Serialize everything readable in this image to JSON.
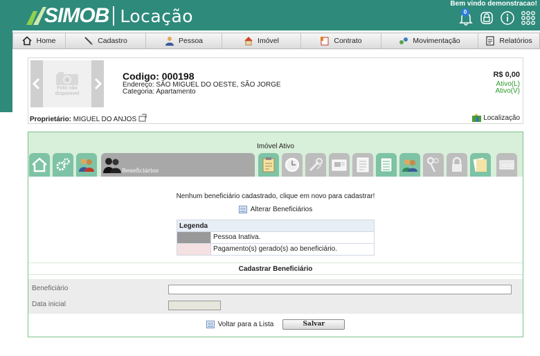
{
  "header": {
    "logo_simob": "SIMOB",
    "logo_locacao": "Locação",
    "welcome": "Bem vindo demonstracao!",
    "notifications_count": "0",
    "icons": [
      "bell-icon",
      "lock-icon",
      "info-icon",
      "apps-grid-icon"
    ]
  },
  "nav": {
    "items": [
      {
        "label": "Home",
        "icon": "home-icon"
      },
      {
        "label": "Cadastro",
        "icon": "pen-icon"
      },
      {
        "label": "Pessoa",
        "icon": "person-icon"
      },
      {
        "label": "Imóvel",
        "icon": "house-icon"
      },
      {
        "label": "Contrato",
        "icon": "contract-icon"
      },
      {
        "label": "Movimentação",
        "icon": "exchange-icon"
      },
      {
        "label": "Relatórios",
        "icon": "report-icon"
      }
    ]
  },
  "property": {
    "no_photo_l1": "Foto não",
    "no_photo_l2": "disponível",
    "codigo": "Codigo:  000198",
    "endereco": "Endereço:  SÃO MIGUEL DO OESTE, SÃO JORGE",
    "categoria": "Categoria:  Apartamento",
    "valor": "R$ 0,00",
    "ativo_l": "Ativo(L)",
    "ativo_v": "Ativo(V)",
    "proprietario_label": "Proprietário:",
    "proprietario_name": " MIGUEL DO ANJOS",
    "localizacao": "Localização"
  },
  "panel": {
    "status_title": "Imóvel Ativo",
    "active_tab": "Beneficiários",
    "message": "Nenhum beneficiário cadastrado, clique em novo para cadastrar!",
    "alterar_link": "Alterar Beneficiários",
    "legend": {
      "title": "Legenda",
      "rows": [
        {
          "color": "#999999",
          "text": "Pessoa Inativa."
        },
        {
          "color": "#f5e1e1",
          "text": "Pagamento(s) gerado(s) ao beneficiário."
        }
      ]
    },
    "cadastrar_title": "Cadastrar Beneficiário",
    "form": {
      "beneficiario_label": "Beneficiário",
      "beneficiario_value": "",
      "data_inicial_label": "Data inicial",
      "data_inicial_value": ""
    },
    "voltar_link": "Voltar para a Lista",
    "salvar_button": "Salvar"
  },
  "colors": {
    "brand_teal": "#2e8a7b",
    "panel_green": "#d8efd9",
    "tile_green": "#7ec3a6",
    "tile_gray": "#bdbdbd"
  }
}
